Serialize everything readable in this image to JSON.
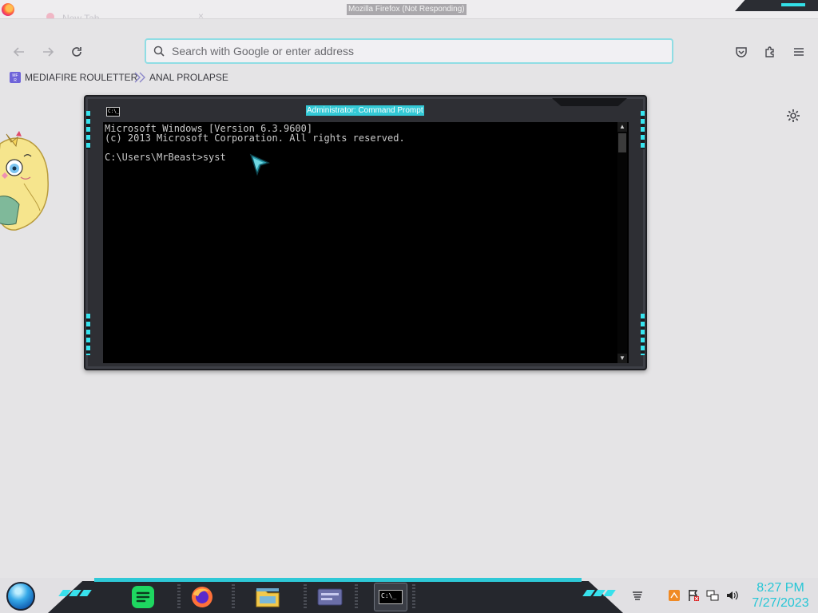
{
  "browser": {
    "window_title": "Mozilla Firefox (Not Responding)",
    "tab_title": "New Tab",
    "tab_close": "×",
    "search_placeholder": "Search with Google or enter address",
    "bookmarks": [
      {
        "label": "MEDIAFIRE ROULETTER",
        "icon": "mediafire-icon"
      },
      {
        "label": "ANAL PROLAPSE",
        "icon": "bookmark-folder-icon"
      }
    ]
  },
  "cmd": {
    "title": "Administrator: Command Prompt",
    "icon_text": "C:\\_",
    "lines": [
      "Microsoft Windows [Version 6.3.9600]",
      "(c) 2013 Microsoft Corporation. All rights reserved.",
      "",
      "C:\\Users\\MrBeast>syst"
    ],
    "scroll_up": "▲",
    "scroll_down": "▼"
  },
  "taskbar": {
    "apps": [
      {
        "name": "spotify",
        "icon": "spotify-icon"
      },
      {
        "name": "firefox",
        "icon": "firefox-icon"
      },
      {
        "name": "file-explorer",
        "icon": "folder-icon"
      },
      {
        "name": "control-panel",
        "icon": "window-panel-icon"
      },
      {
        "name": "command-prompt",
        "icon": "cmd-icon",
        "active": true,
        "icon_text": "C:\\_"
      }
    ],
    "tray_icons": [
      "show-hidden-icons",
      "updates-icon",
      "action-center-flag-icon",
      "network-icon",
      "volume-icon"
    ],
    "time": "8:27 PM",
    "date": "7/27/2023"
  },
  "colors": {
    "accent": "#33e0e8",
    "clock": "#25c6d6",
    "url_focus": "#8fdde4"
  }
}
